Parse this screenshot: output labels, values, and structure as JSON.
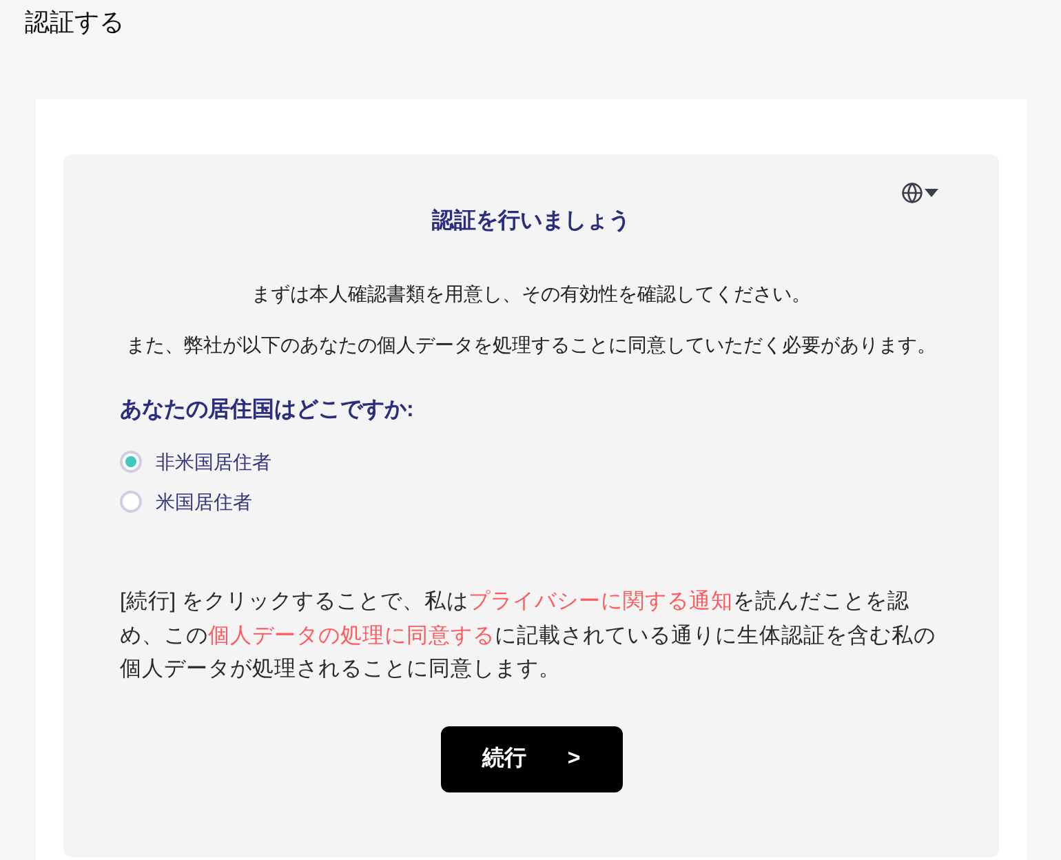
{
  "page": {
    "title": "認証する"
  },
  "card": {
    "heading": "認証を行いましょう",
    "intro": [
      "まずは本人確認書類を用意し、その有効性を確認してください。",
      "また、弊社が以下のあなたの個人データを処理することに同意していただく必要があります。"
    ],
    "residency": {
      "question": "あなたの居住国はどこですか:",
      "options": [
        {
          "label": "非米国居住者",
          "selected": true
        },
        {
          "label": "米国居住者",
          "selected": false
        }
      ]
    },
    "consent": [
      {
        "kind": "text",
        "text": "[続行] をクリックすることで、私は"
      },
      {
        "kind": "link",
        "text": "プライバシーに関する通知"
      },
      {
        "kind": "text",
        "text": "を読んだことを認め、この"
      },
      {
        "kind": "link",
        "text": "個人データの処理に同意する"
      },
      {
        "kind": "text",
        "text": "に記載されている通りに生体認証を含む私の個人データが処理されることに同意します。"
      }
    ],
    "button": {
      "label": "続行",
      "arrow": ">"
    }
  }
}
